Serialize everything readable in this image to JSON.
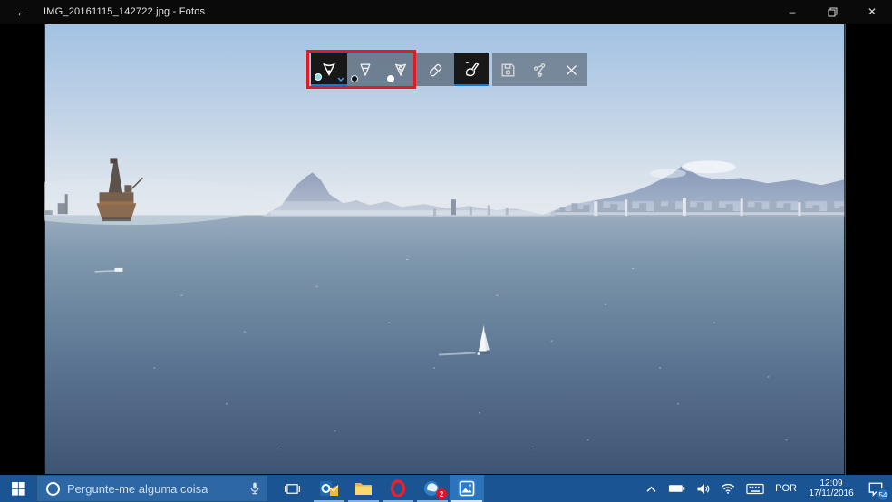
{
  "titlebar": {
    "back_glyph": "←",
    "title": "IMG_20161115_142722.jpg - Fotos",
    "minimize_glyph": "–",
    "close_glyph": "✕"
  },
  "ink_toolbar": {
    "tools": [
      "ballpoint-pen",
      "pencil",
      "calligraphy-pen",
      "eraser",
      "touch-writing",
      "save",
      "share",
      "close-ink"
    ],
    "selected": [
      "ballpoint-pen",
      "touch-writing"
    ],
    "highlight_color": "#e01b24",
    "accent_underline_color": "#0f7bd7",
    "ballpoint_ink_color": "#8ed6e8",
    "pencil_ink_color": "#141414",
    "calligraphy_ink_color": "#ffffff"
  },
  "taskbar": {
    "search": {
      "placeholder": "Pergunte-me alguma coisa"
    },
    "apps": [
      "outlook",
      "file-explorer",
      "opera",
      "notification-app",
      "photos"
    ],
    "active_app": "photos",
    "notification_app_badge": "2",
    "tray": {
      "language": "POR",
      "time": "12:09",
      "date": "17/11/2016",
      "notification_count": "54"
    }
  },
  "colors": {
    "titlebar_bg": "#0a0a0a",
    "taskbar_bg": "#1a5492",
    "search_box_bg": "#2e68a4",
    "active_app_bg": "#2d73ba"
  }
}
